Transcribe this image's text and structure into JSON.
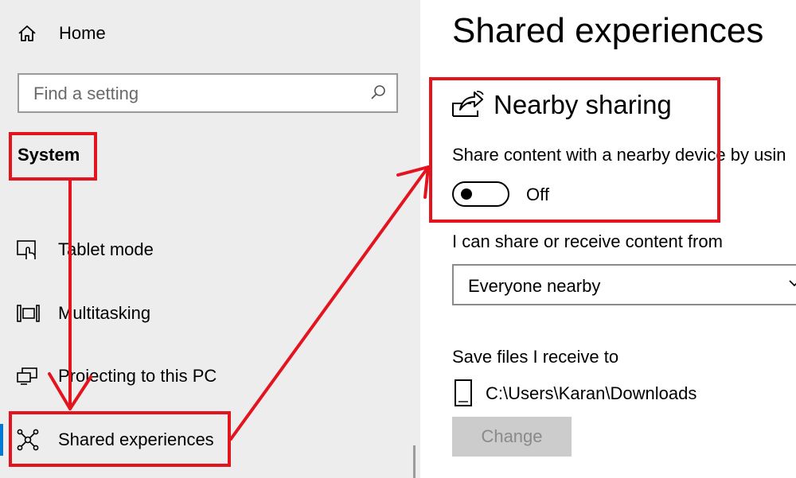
{
  "nav": {
    "home_label": "Home",
    "search_placeholder": "Find a setting",
    "section_title": "System",
    "items": [
      {
        "label": "Tablet mode",
        "icon": "tablet-mode-icon"
      },
      {
        "label": "Multitasking",
        "icon": "multitasking-icon"
      },
      {
        "label": "Projecting to this PC",
        "icon": "projecting-icon"
      },
      {
        "label": "Shared experiences",
        "icon": "shared-experiences-icon",
        "selected": true
      }
    ]
  },
  "main": {
    "title": "Shared experiences",
    "nearby_sharing": {
      "heading": "Nearby sharing",
      "description": "Share content with a nearby device by usin",
      "toggle_state": "Off"
    },
    "share_from": {
      "label": "I can share or receive content from",
      "selected": "Everyone nearby"
    },
    "save_files": {
      "label": "Save files I receive to",
      "path": "C:\\Users\\Karan\\Downloads",
      "button_label": "Change"
    }
  },
  "colors": {
    "annotation": "#e4141f",
    "nav_background": "#ededed",
    "accent": "#0078d4",
    "disabled_button": "#cccccc"
  }
}
